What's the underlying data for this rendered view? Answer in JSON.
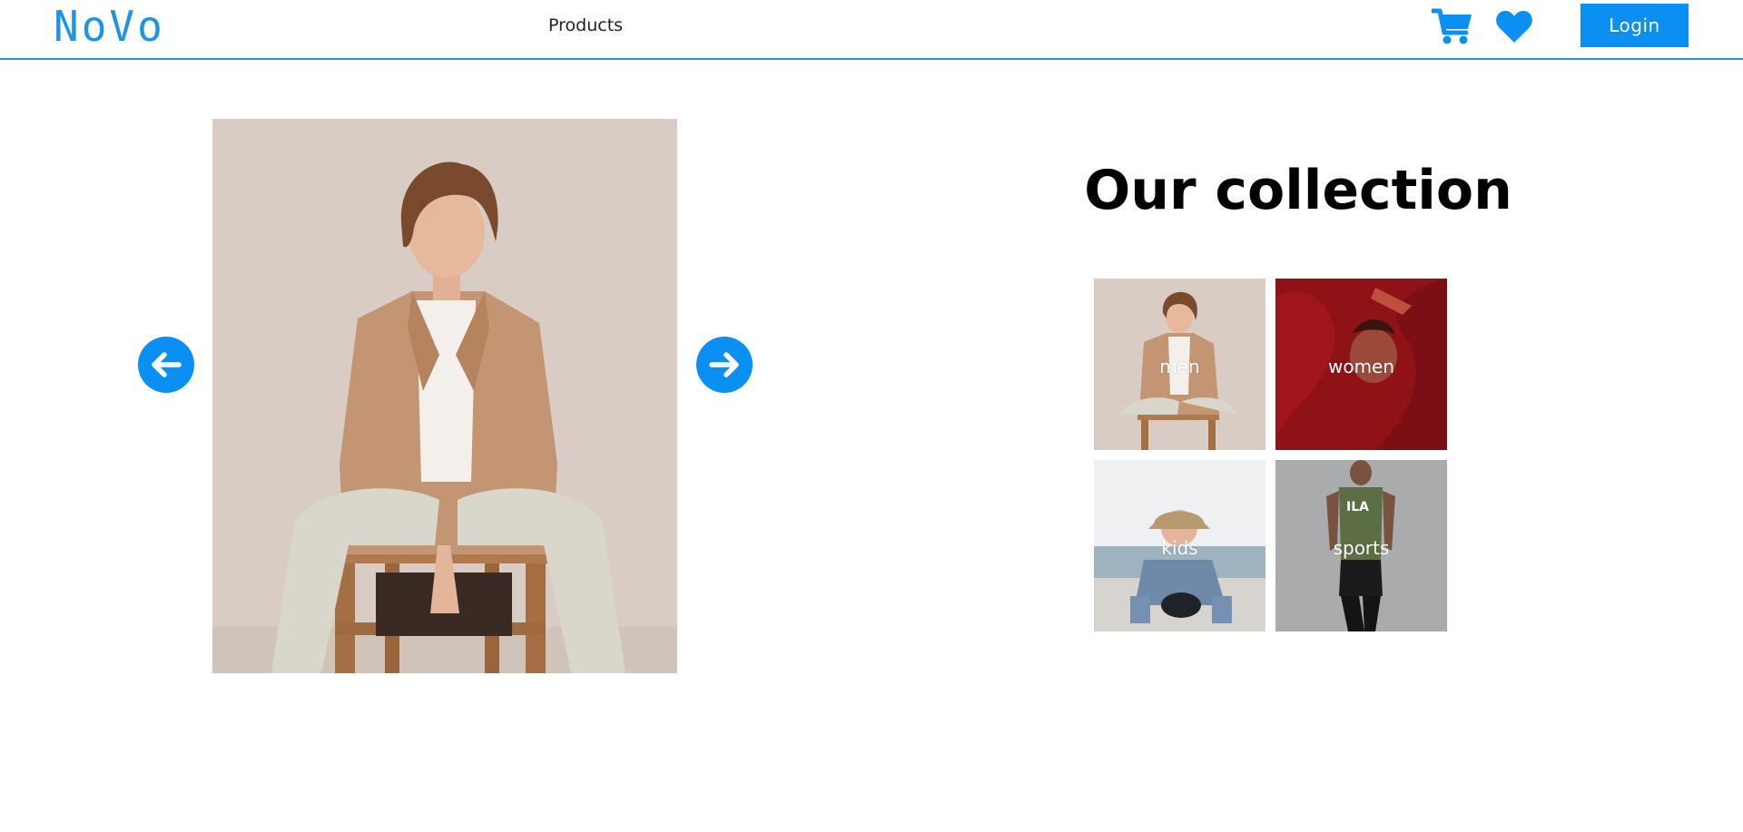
{
  "header": {
    "brand": "NoVo",
    "nav_products": "Products",
    "cart_icon": "cart-icon",
    "wishlist_icon": "heart-icon",
    "login_label": "Login"
  },
  "slider": {
    "image": "man-in-tan-blazer-sitting-on-stool",
    "prev_icon": "arrow-left-icon",
    "next_icon": "arrow-right-icon"
  },
  "collection": {
    "title": "Our collection",
    "categories": [
      {
        "label": "men"
      },
      {
        "label": "women"
      },
      {
        "label": "kids"
      },
      {
        "label": "sports"
      }
    ]
  },
  "colors": {
    "accent": "#0a8ff2",
    "border": "#1a93e8"
  }
}
